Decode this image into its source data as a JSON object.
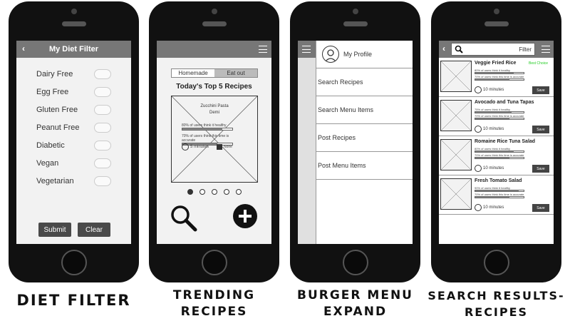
{
  "captions": {
    "diet_filter": "DIET FILTER",
    "trending_line1": "TRENDING",
    "trending_line2": "RECIPES",
    "burger_line1": "BURGER MENU",
    "burger_line2": "EXPAND",
    "search_line1": "SEARCH RESULTS-",
    "search_line2": "RECIPES"
  },
  "diet_filter": {
    "back": "‹",
    "title": "My Diet Filter",
    "options": [
      "Dairy Free",
      "Egg Free",
      "Gluten Free",
      "Peanut Free",
      "Diabetic",
      "Vegan",
      "Vegetarian"
    ],
    "submit": "Submit",
    "clear": "Clear"
  },
  "trending": {
    "tabs": [
      "Homemade",
      "Eat out"
    ],
    "active_tab": "Homemade",
    "heading": "Today's Top 5 Recipes",
    "recipe_name_line1": "Zucchini Pasta",
    "recipe_name_line2": "Demi",
    "healthy_text": "80% of users think it healthy",
    "healthy_pct": 80,
    "accurate_text": "70% of users think this time is accurate",
    "accurate_pct": 70,
    "time": "5 minutes",
    "cost": "None",
    "carousel_count": 5,
    "carousel_active": 1
  },
  "burger": {
    "profile": "My Profile",
    "items": [
      "Search Recipes",
      "Search Menu Items",
      "Post Recipes",
      "Post Menu Items"
    ]
  },
  "search": {
    "back": "‹",
    "filter_label": "Filter",
    "results": [
      {
        "name": "Veggie Fried Rice",
        "badge": "Best Choice",
        "healthy_text": "80% of users think it healthy",
        "healthy_pct": 80,
        "accurate_text": "70% of users think this time is accurate",
        "accurate_pct": 70,
        "time": "10 minutes",
        "save": "Save"
      },
      {
        "name": "Avocado and Tuna Tapas",
        "healthy_text": "75% of users think it healthy",
        "healthy_pct": 75,
        "accurate_text": "70% of users think this time is accurate",
        "accurate_pct": 70,
        "time": "10 minutes",
        "save": "Save"
      },
      {
        "name": "Romaine Rice Tuna Salad",
        "healthy_text": "80% of users think it healthy",
        "healthy_pct": 80,
        "accurate_text": "70% of users think this time is accurate",
        "accurate_pct": 70,
        "time": "10 minutes",
        "save": "Save"
      },
      {
        "name": "Fresh Tomato Salad",
        "healthy_text": "90% of users think it healthy",
        "healthy_pct": 90,
        "accurate_text": "70% of users think this time is accurate",
        "accurate_pct": 70,
        "time": "10 minutes",
        "save": "Save"
      }
    ]
  },
  "colors": {
    "phone": "#111111",
    "header": "#777777",
    "badge": "#22cc22",
    "button": "#4a4a4a"
  }
}
